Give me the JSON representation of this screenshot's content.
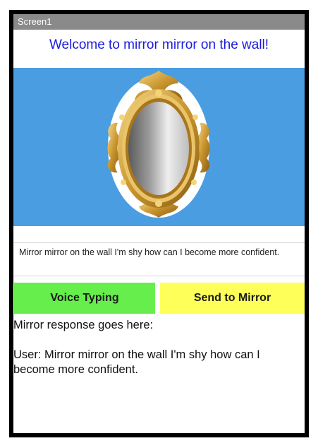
{
  "app": {
    "screen_title": "Screen1",
    "welcome_text": "Welcome to mirror mirror on the wall!"
  },
  "mirror": {
    "icon": "ornate-gold-mirror",
    "background_color": "#4a9de0"
  },
  "input": {
    "value": "Mirror mirror on the wall I'm shy how can I become more confident."
  },
  "buttons": {
    "voice_typing_label": "Voice Typing",
    "voice_typing_color": "#66ee4c",
    "send_label": "Send to Mirror",
    "send_color": "#ffff5a"
  },
  "response": {
    "header": "Mirror response goes here:",
    "body": "User: Mirror mirror on the wall I'm shy how can I become more confident."
  }
}
